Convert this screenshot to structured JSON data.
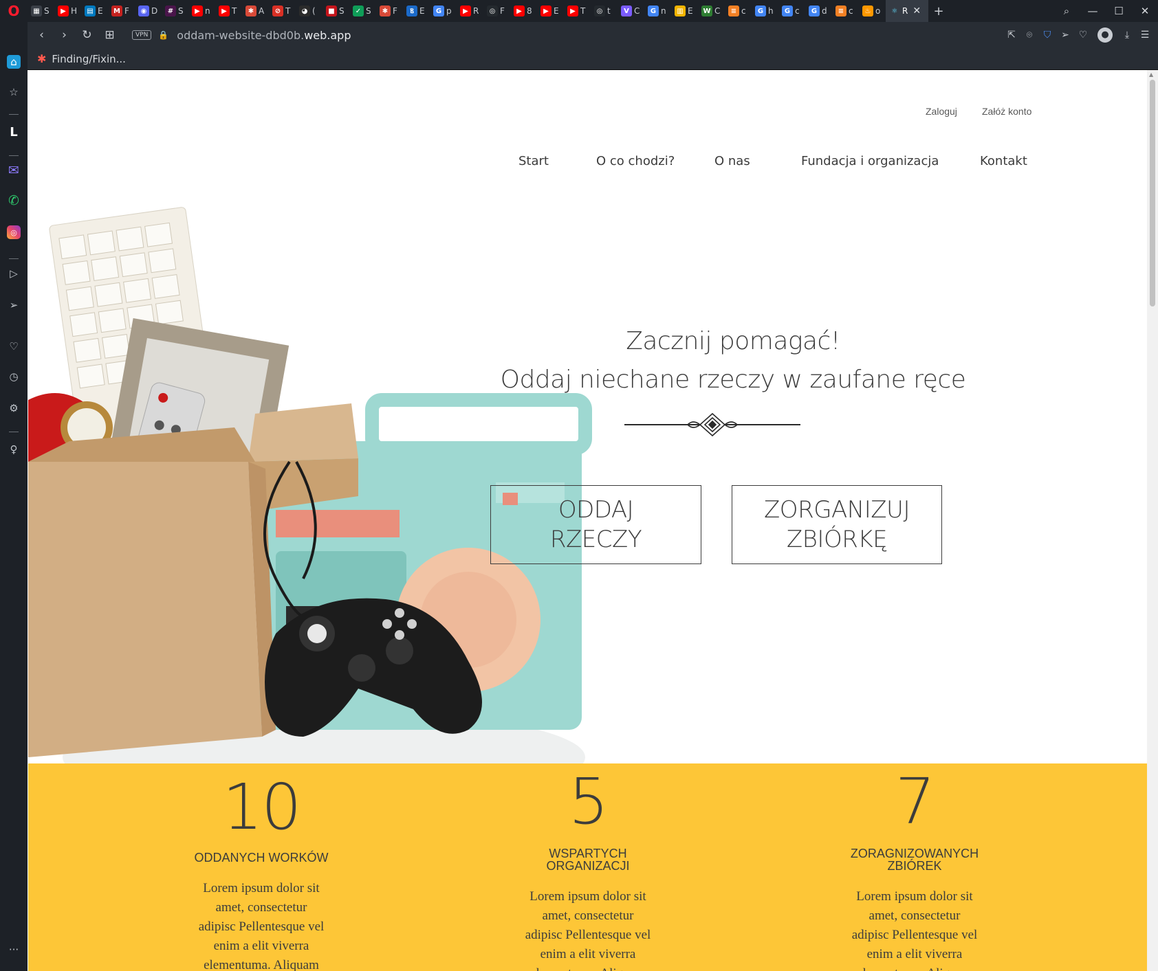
{
  "browser": {
    "tabs": [
      {
        "label": "S",
        "color": "#3a3f47",
        "glyph": "▦"
      },
      {
        "label": "H",
        "color": "#ff0000",
        "glyph": "▶"
      },
      {
        "label": "E",
        "color": "#0079bf",
        "glyph": "▤"
      },
      {
        "label": "F",
        "color": "#c5221f",
        "glyph": "M"
      },
      {
        "label": "D",
        "color": "#5865f2",
        "glyph": "◉"
      },
      {
        "label": "S",
        "color": "#4a154b",
        "glyph": "#"
      },
      {
        "label": "n",
        "color": "#ff0000",
        "glyph": "▶"
      },
      {
        "label": "T",
        "color": "#ff0000",
        "glyph": "▶"
      },
      {
        "label": "A",
        "color": "#d94a38",
        "glyph": "✱"
      },
      {
        "label": "T",
        "color": "#d93025",
        "glyph": "⊘"
      },
      {
        "label": "(",
        "color": "#2b2b2b",
        "glyph": "◕"
      },
      {
        "label": "S",
        "color": "#c4151c",
        "glyph": "■"
      },
      {
        "label": "S",
        "color": "#0f9d58",
        "glyph": "✓"
      },
      {
        "label": "F",
        "color": "#d94a38",
        "glyph": "✱"
      },
      {
        "label": "E",
        "color": "#1b6ac9",
        "glyph": "Ⲃ"
      },
      {
        "label": "p",
        "color": "#4285f4",
        "glyph": "G"
      },
      {
        "label": "R",
        "color": "#ff0000",
        "glyph": "▶"
      },
      {
        "label": "F",
        "color": "#24292e",
        "glyph": "◎"
      },
      {
        "label": "8",
        "color": "#ff0000",
        "glyph": "▶"
      },
      {
        "label": "E",
        "color": "#ff0000",
        "glyph": "▶"
      },
      {
        "label": "T",
        "color": "#ff0000",
        "glyph": "▶"
      },
      {
        "label": "t",
        "color": "#24292e",
        "glyph": "◎"
      },
      {
        "label": "C",
        "color": "#7b5cff",
        "glyph": "V"
      },
      {
        "label": "n",
        "color": "#4285f4",
        "glyph": "G"
      },
      {
        "label": "E",
        "color": "#f4b400",
        "glyph": "▥"
      },
      {
        "label": "C",
        "color": "#2e7d32",
        "glyph": "W"
      },
      {
        "label": "c",
        "color": "#f48024",
        "glyph": "≡"
      },
      {
        "label": "h",
        "color": "#4285f4",
        "glyph": "G"
      },
      {
        "label": "c",
        "color": "#4285f4",
        "glyph": "G"
      },
      {
        "label": "d",
        "color": "#4285f4",
        "glyph": "G"
      },
      {
        "label": "c",
        "color": "#f48024",
        "glyph": "≡"
      },
      {
        "label": "o",
        "color": "#ff9800",
        "glyph": "♨"
      }
    ],
    "active_tab": {
      "label": "R",
      "glyph": "⚛",
      "close": "✕"
    },
    "new_tab": "+",
    "window": {
      "search": "⌕",
      "minimize": "—",
      "maximize": "☐",
      "close": "✕"
    },
    "nav": {
      "back": "‹",
      "forward": "›",
      "reload": "↻",
      "grid": "⊞"
    },
    "vpn_badge": "VPN",
    "lock": "🔒",
    "url_prefix": "oddam-website-dbd0b.",
    "url_domain": "web.app",
    "bookmark": {
      "label": "Finding/Fixin..."
    },
    "addr_icons": [
      "⇱",
      "⌾",
      "⛉",
      "➢",
      "♡"
    ],
    "profile": "●",
    "download": "⤓",
    "menu": "☰"
  },
  "header": {
    "auth": {
      "login": "Zaloguj",
      "register": "Załóż konto"
    },
    "nav": [
      "Start",
      "O co chodzi?",
      "O nas",
      "Fundacja i organizacja",
      "Kontakt"
    ]
  },
  "hero": {
    "title_line1": "Zacznij pomagać!",
    "title_line2": "Oddaj niechane rzeczy w zaufane ręce",
    "btn_give_line1": "ODDAJ",
    "btn_give_line2": "RZECZY",
    "btn_collect_line1": "ZORGANIZUJ",
    "btn_collect_line2": "ZBIÓRKĘ"
  },
  "stats": [
    {
      "number": "10",
      "label": "ODDANYCH WORKÓW",
      "desc": "Lorem ipsum dolor sit amet, consectetur adipisc Pellentesque vel enim a elit viverra elementuma. Aliquam"
    },
    {
      "number": "5",
      "label_line1": "WSPARTYCH",
      "label_line2": "ORGANIZACJI",
      "desc": "Lorem ipsum dolor sit amet, consectetur adipisc Pellentesque vel enim a elit viverra elementuma. Aliquam"
    },
    {
      "number": "7",
      "label_line1": "ZORAGNIZOWANYCH",
      "label_line2": "ZBIÓREK",
      "desc": "Lorem ipsum dolor sit amet, consectetur adipisc Pellentesque vel enim a elit viverra elementuma. Aliquam"
    }
  ],
  "colors": {
    "stats_bg": "#fdc637",
    "text": "#3c3c3c",
    "radio": "#8fd3cc",
    "box": "#d2ae84"
  }
}
